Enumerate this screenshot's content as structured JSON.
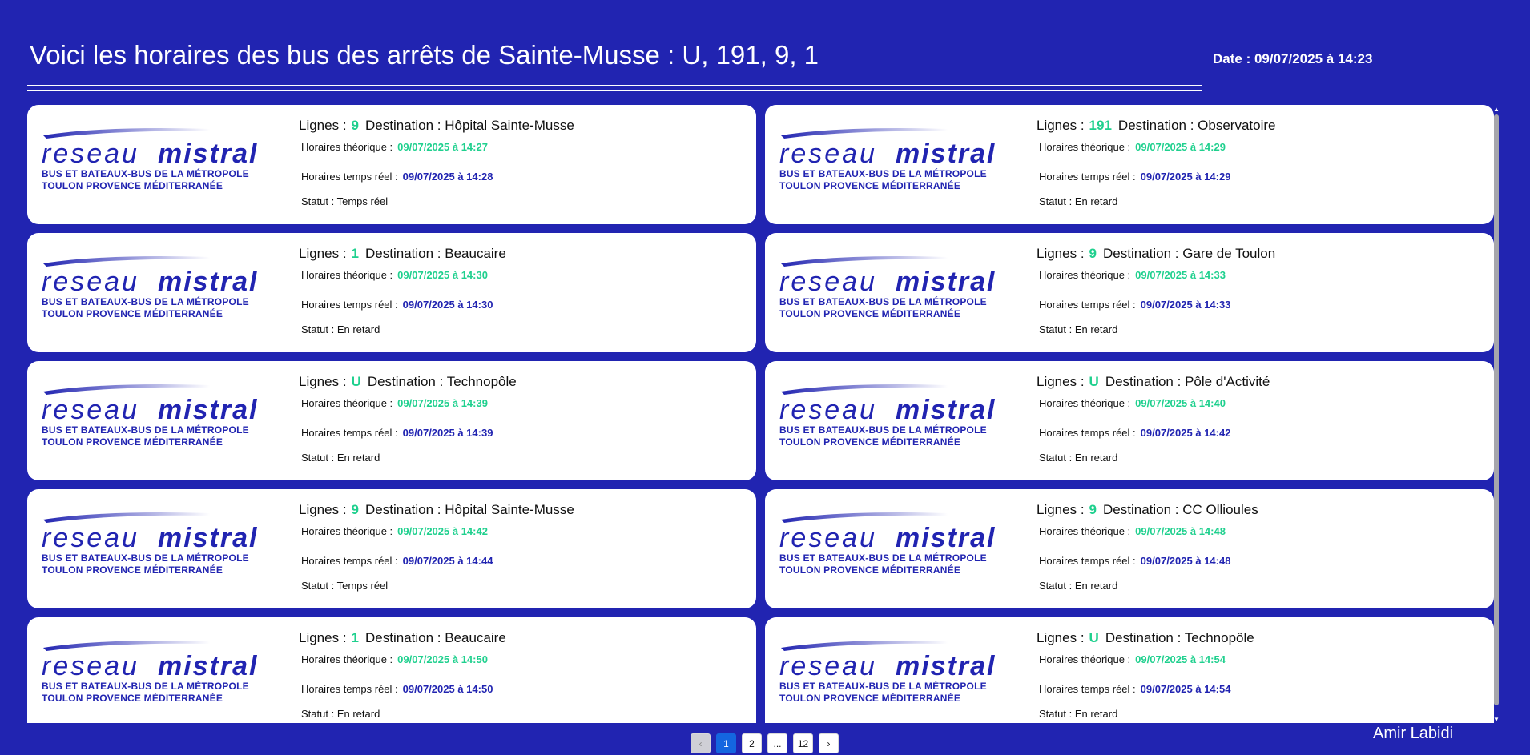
{
  "header": {
    "title": "Voici les horaires des bus des arrêts de Sainte-Musse : U, 191, 9, 1",
    "date": "Date : 09/07/2025 à 14:23"
  },
  "brand": {
    "logo_left": "reseau",
    "logo_right": "mistral",
    "sub_line1": "BUS ET BATEAUX-BUS DE LA MÉTROPOLE",
    "sub_line2": "TOULON PROVENCE MÉDITERRANÉE",
    "color": "#2124b1"
  },
  "labels": {
    "lines": "Lignes :",
    "destination": "Destination :",
    "theoretical": "Horaires théorique :",
    "realtime": "Horaires temps réel :",
    "status": "Statut :"
  },
  "colors": {
    "background": "#2124b1",
    "line_number": "#1fd08e",
    "theoretical_time": "#1fd08e",
    "realtime_time": "#2124b1",
    "active_page": "#1466e0"
  },
  "departures": [
    {
      "line": "9",
      "destination": "Hôpital Sainte-Musse",
      "theoretical": "09/07/2025 à 14:27",
      "realtime": "09/07/2025 à 14:28",
      "status": "Temps réel"
    },
    {
      "line": "191",
      "destination": "Observatoire",
      "theoretical": "09/07/2025 à 14:29",
      "realtime": "09/07/2025 à 14:29",
      "status": "En retard"
    },
    {
      "line": "1",
      "destination": "Beaucaire",
      "theoretical": "09/07/2025 à 14:30",
      "realtime": "09/07/2025 à 14:30",
      "status": "En retard"
    },
    {
      "line": "9",
      "destination": "Gare de Toulon",
      "theoretical": "09/07/2025 à 14:33",
      "realtime": "09/07/2025 à 14:33",
      "status": "En retard"
    },
    {
      "line": "U",
      "destination": "Technopôle",
      "theoretical": "09/07/2025 à 14:39",
      "realtime": "09/07/2025 à 14:39",
      "status": "En retard"
    },
    {
      "line": "U",
      "destination": "Pôle d'Activité",
      "theoretical": "09/07/2025 à 14:40",
      "realtime": "09/07/2025 à 14:42",
      "status": "En retard"
    },
    {
      "line": "9",
      "destination": "Hôpital Sainte-Musse",
      "theoretical": "09/07/2025 à 14:42",
      "realtime": "09/07/2025 à 14:44",
      "status": "Temps réel"
    },
    {
      "line": "9",
      "destination": "CC Ollioules",
      "theoretical": "09/07/2025 à 14:48",
      "realtime": "09/07/2025 à 14:48",
      "status": "En retard"
    },
    {
      "line": "1",
      "destination": "Beaucaire",
      "theoretical": "09/07/2025 à 14:50",
      "realtime": "09/07/2025 à 14:50",
      "status": "En retard"
    },
    {
      "line": "U",
      "destination": "Technopôle",
      "theoretical": "09/07/2025 à 14:54",
      "realtime": "09/07/2025 à 14:54",
      "status": "En retard"
    }
  ],
  "pagination": {
    "prev_icon": "chevron-left-icon",
    "pages": [
      "1",
      "2",
      "...",
      "12"
    ],
    "active": "1",
    "next_icon": "chevron-right-icon"
  },
  "footer": {
    "author": "Amir Labidi"
  }
}
